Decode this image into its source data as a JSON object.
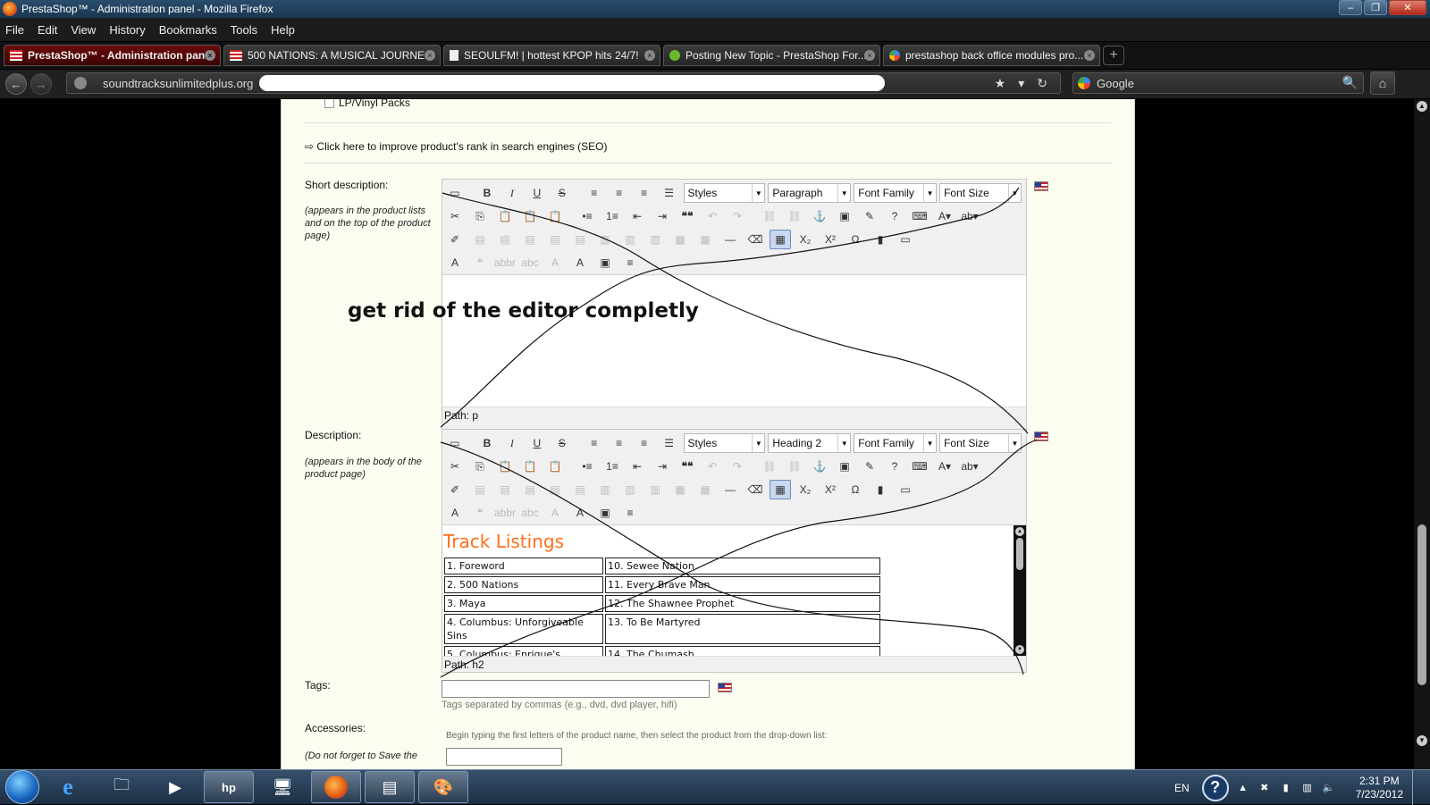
{
  "window": {
    "title": "PrestaShop™ - Administration panel - Mozilla Firefox",
    "controls": [
      "‒",
      "❐",
      "✕"
    ]
  },
  "menu": [
    "File",
    "Edit",
    "View",
    "History",
    "Bookmarks",
    "Tools",
    "Help"
  ],
  "tabs": [
    {
      "label": "PrestaShop™ - Administration panel",
      "icon": "flag-icon",
      "active": true
    },
    {
      "label": "500 NATIONS: A MUSICAL JOURNE...",
      "icon": "flag-icon",
      "active": false
    },
    {
      "label": "SEOULFM! | hottest KPOP hits 24/7!",
      "icon": "page-icon",
      "active": false
    },
    {
      "label": "Posting New Topic - PrestaShop For...",
      "icon": "prestashop-icon",
      "active": false
    },
    {
      "label": "prestashop back office modules pro...",
      "icon": "google-icon",
      "active": false
    }
  ],
  "nav": {
    "url": "soundtracksunlimitedplus.org",
    "search_engine": "Google"
  },
  "form": {
    "category_leaf": "LP/Vinyl Packs",
    "seo_link": "Click here to improve product's rank in search engines (SEO)",
    "short_desc": {
      "label": "Short description:",
      "hint": "(appears in the product lists and on the top of the product page)",
      "styles": "Styles",
      "format": "Paragraph",
      "font_family": "Font Family",
      "font_size": "Font Size",
      "path": "Path: p"
    },
    "description": {
      "label": "Description:",
      "hint": "(appears in the body of the product page)",
      "styles": "Styles",
      "format": "Heading 2",
      "font_family": "Font Family",
      "font_size": "Font Size",
      "path": "Path: h2",
      "heading": "Track Listings",
      "tracks": [
        [
          "1. Foreword",
          "10. Sewee Nation"
        ],
        [
          "2. 500 Nations",
          "11. Every Brave Man"
        ],
        [
          "3. Maya",
          "12. The Shawnee Prophet"
        ],
        [
          "4. Columbus: Unforgiveable Sins",
          "13. To Be Martyred"
        ],
        [
          "5. Columbus: Enrique's",
          "14. The Chumash"
        ]
      ]
    },
    "tags": {
      "label": "Tags:",
      "value": "",
      "hint": "Tags separated by commas (e.g., dvd, dvd player, hifi)"
    },
    "accessories": {
      "label": "Accessories:",
      "hint": "Begin typing the first letters of the product name, then select the product from the drop-down list:",
      "note": "(Do not forget to Save the"
    }
  },
  "annotation": "get rid of the editor completly",
  "taskbar": {
    "lang": "EN",
    "time": "2:31 PM",
    "date": "7/23/2012"
  },
  "colors": {
    "accent_heading": "#ff6f16",
    "active_tab": "#5a0808",
    "page_bg": "#fcfdf1"
  }
}
